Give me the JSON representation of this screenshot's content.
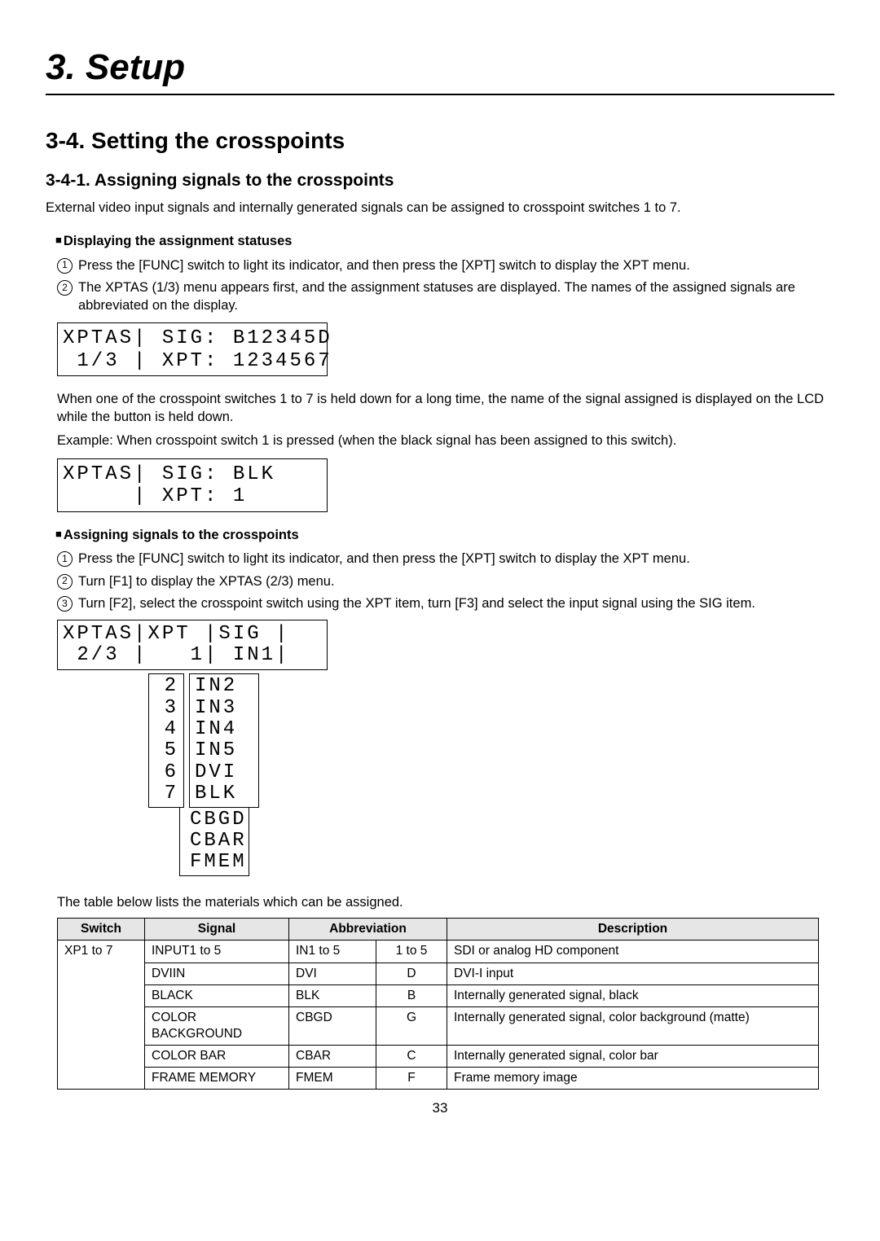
{
  "chapter": "3. Setup",
  "section": "3-4. Setting the crosspoints",
  "subsection": "3-4-1. Assigning signals to the crosspoints",
  "intro": "External video input signals and internally generated signals can be assigned to crosspoint switches 1 to 7.",
  "heading_display": "Displaying the assignment statuses",
  "display_steps": {
    "s1": "Press the [FUNC] switch to light its indicator, and then press the [XPT] switch to display the XPT menu.",
    "s2": "The XPTAS (1/3) menu appears first, and the assignment statuses are displayed. The names of the assigned signals are abbreviated on the display."
  },
  "lcd1_l1": "XPTAS| SIG: B12345D",
  "lcd1_l2": " 1/3 | XPT: 1234567",
  "display_after_p1": "When one of the crosspoint switches 1 to 7 is held down for a long time, the name of the signal assigned is displayed on the LCD while the button is held down.",
  "display_after_p2": "Example: When crosspoint switch 1 is pressed (when the black signal has been assigned to this switch).",
  "lcd2_l1": "XPTAS| SIG: BLK",
  "lcd2_l2": "     | XPT: 1",
  "heading_assign": "Assigning signals to the crosspoints",
  "assign_steps": {
    "s1": "Press the [FUNC] switch to light its indicator, and then press the [XPT] switch to display the XPT menu.",
    "s2": "Turn [F1] to display the XPTAS (2/3) menu.",
    "s3": "Turn [F2], select the crosspoint switch using the XPT item, turn [F3] and select the input signal using the SIG item."
  },
  "menu_top_l1": "XPTAS|XPT |SIG |",
  "menu_top_l2": " 2/3 |   1| IN1|",
  "menu_xpt": [
    "2",
    "3",
    "4",
    "5",
    "6",
    "7"
  ],
  "menu_sig": [
    "IN2",
    "IN3",
    "IN4",
    "IN5",
    "DVI",
    "BLK"
  ],
  "menu_sig_extra": [
    "CBGD",
    "CBAR",
    "FMEM"
  ],
  "table_intro": "The table below lists the materials which can be assigned.",
  "table": {
    "headers": {
      "c0": "Switch",
      "c1": "Signal",
      "c2": "Abbreviation",
      "c3": "Description"
    },
    "switch_cell": "XP1 to 7",
    "rows": [
      {
        "sig": "INPUT1 to 5",
        "abv": "IN1 to 5",
        "idx": "1 to 5",
        "desc": "SDI or analog HD component"
      },
      {
        "sig": "DVIIN",
        "abv": "DVI",
        "idx": "D",
        "desc": "DVI-I input"
      },
      {
        "sig": "BLACK",
        "abv": "BLK",
        "idx": "B",
        "desc": "Internally generated signal, black"
      },
      {
        "sig": "COLOR BACKGROUND",
        "abv": "CBGD",
        "idx": "G",
        "desc": "Internally generated signal, color background (matte)"
      },
      {
        "sig": "COLOR BAR",
        "abv": "CBAR",
        "idx": "C",
        "desc": "Internally generated signal, color bar"
      },
      {
        "sig": "FRAME MEMORY",
        "abv": "FMEM",
        "idx": "F",
        "desc": "Frame memory image"
      }
    ]
  },
  "page_number": "33"
}
